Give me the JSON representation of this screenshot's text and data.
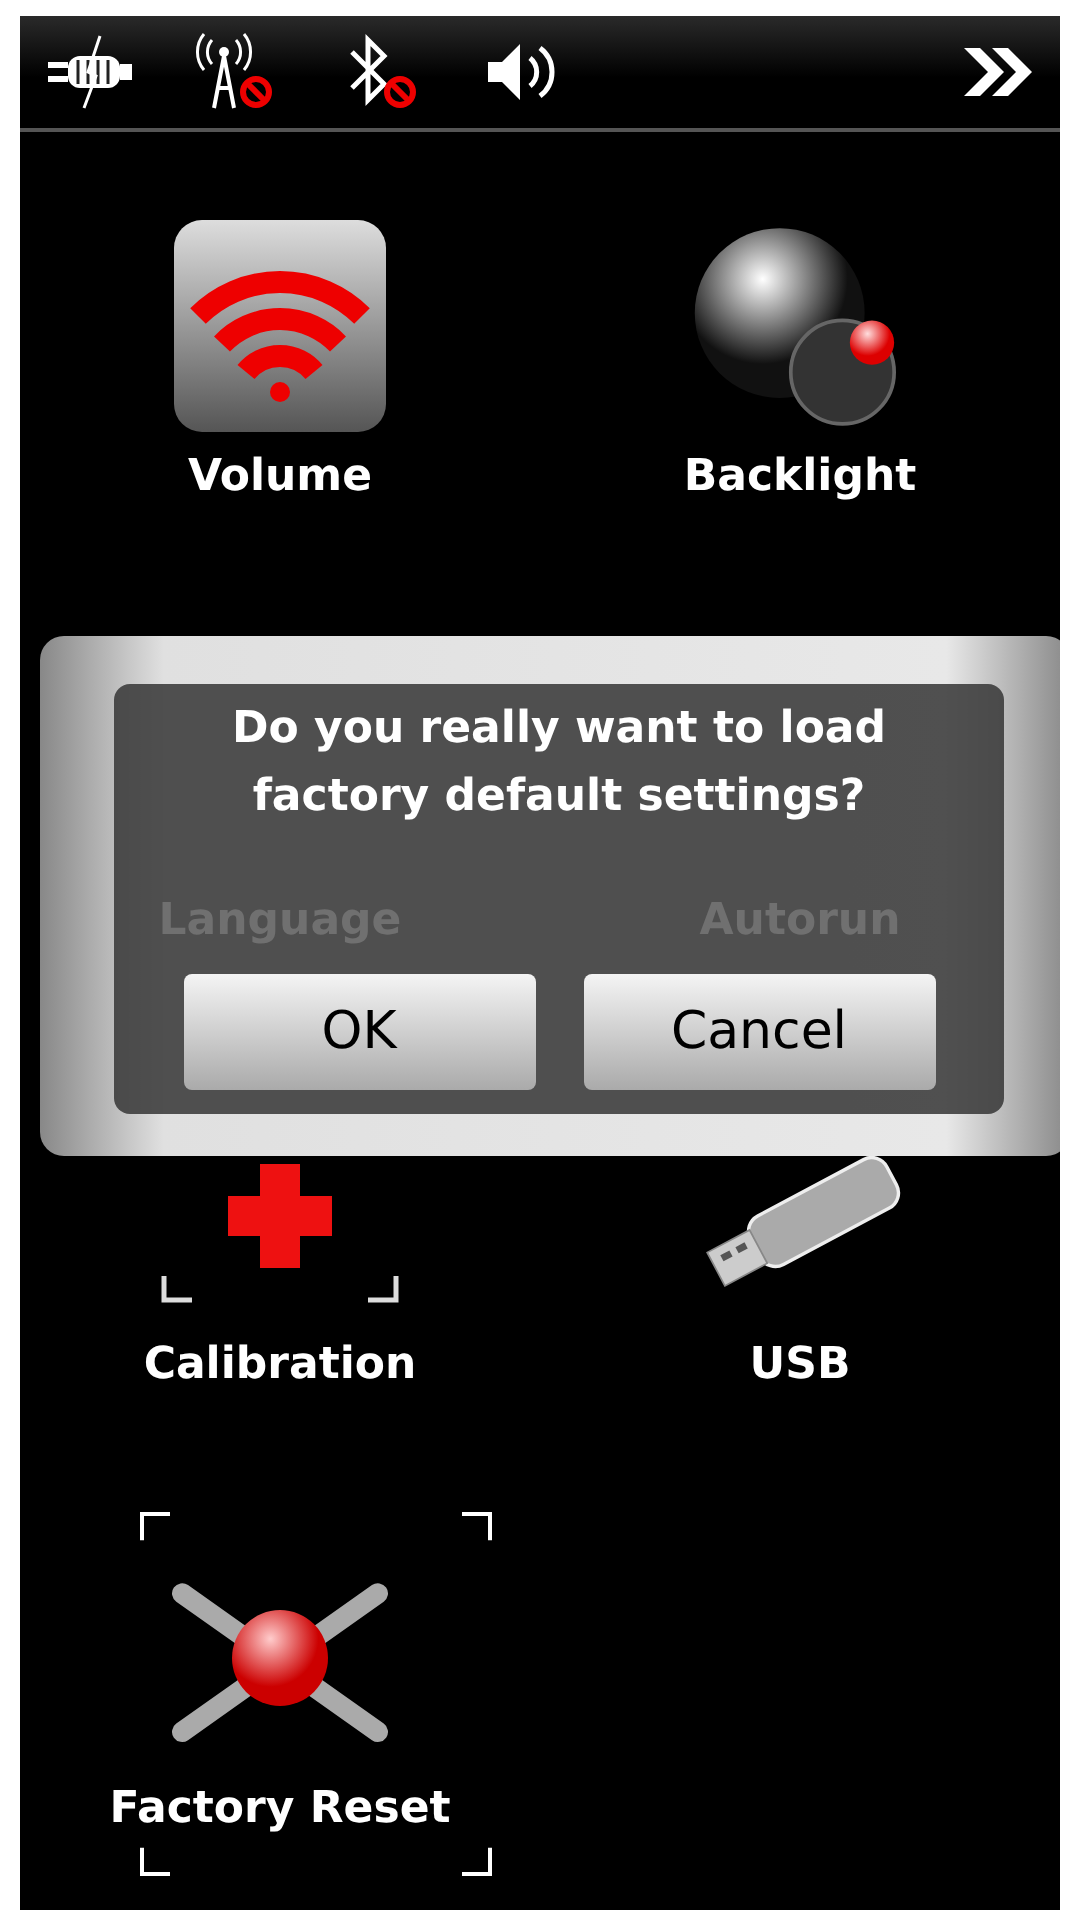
{
  "status_bar": {
    "indicators": [
      {
        "kind": "power",
        "disabled": false
      },
      {
        "kind": "signal",
        "disabled": true
      },
      {
        "kind": "bluetooth",
        "disabled": true
      },
      {
        "kind": "sound",
        "disabled": false
      }
    ]
  },
  "items": [
    {
      "label": "Volume",
      "kind": "volume",
      "selected": false
    },
    {
      "label": "Backlight",
      "kind": "backlight",
      "selected": false
    },
    {
      "label": "Language",
      "kind": "language",
      "selected": false,
      "dimmed": true
    },
    {
      "label": "Autorun",
      "kind": "autorun",
      "selected": false,
      "dimmed": true
    },
    {
      "label": "Calibration",
      "kind": "calibration",
      "selected": false
    },
    {
      "label": "USB",
      "kind": "usb",
      "selected": false
    },
    {
      "label": "Factory Reset",
      "kind": "reset",
      "selected": true
    }
  ],
  "dialog": {
    "message": "Do you really want to load factory default settings?",
    "buttons": [
      "OK",
      "Cancel"
    ]
  }
}
